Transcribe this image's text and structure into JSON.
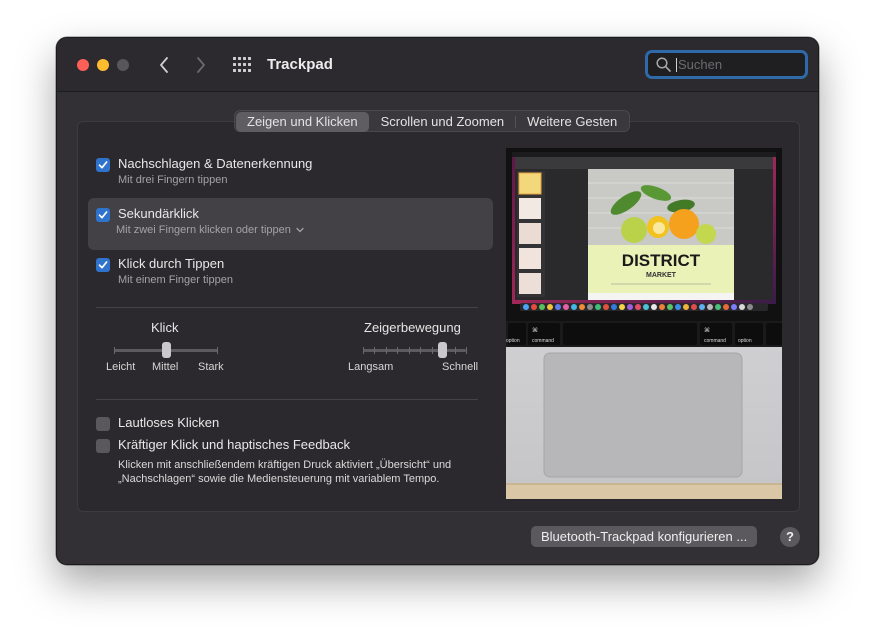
{
  "window": {
    "title": "Trackpad",
    "search_placeholder": "Suchen"
  },
  "tabs": [
    {
      "label": "Zeigen und Klicken",
      "active": true
    },
    {
      "label": "Scrollen und Zoomen",
      "active": false
    },
    {
      "label": "Weitere Gesten",
      "active": false
    }
  ],
  "options": {
    "lookup": {
      "label": "Nachschlagen & Datenerkennung",
      "sub": "Mit drei Fingern tippen",
      "checked": true
    },
    "secondary": {
      "label": "Sekundärklick",
      "sub": "Mit zwei Fingern klicken oder tippen",
      "checked": true
    },
    "tap": {
      "label": "Klick durch Tippen",
      "sub": "Mit einem Finger tippen",
      "checked": true
    },
    "silent": {
      "label": "Lautloses Klicken",
      "checked": false
    },
    "force": {
      "label": "Kräftiger Klick und haptisches Feedback",
      "checked": false,
      "description": "Klicken mit anschließendem kräftigen Druck aktiviert „Übersicht“ und „Nachschlagen“ sowie die Mediensteuerung mit variablem Tempo."
    }
  },
  "sliders": {
    "click": {
      "title": "Klick",
      "min_label": "Leicht",
      "mid_label": "Mittel",
      "max_label": "Stark",
      "steps": 3,
      "value_index": 1
    },
    "pointer": {
      "title": "Zeigerbewegung",
      "min_label": "Langsam",
      "max_label": "Schnell",
      "steps": 10,
      "value_index": 8
    }
  },
  "preview": {
    "poster_title": "DISTRICT",
    "poster_subtitle": "MARKET",
    "key_left_symbol": "⌘",
    "key_left_label": "command",
    "key_right_symbol": "⌘",
    "key_right_label": "command",
    "key_option_label": "option"
  },
  "footer": {
    "bluetooth_button": "Bluetooth-Trackpad konfigurieren ...",
    "help_label": "?"
  },
  "colors": {
    "accent": "#2f73cd",
    "close": "#fe5f57",
    "minimize": "#febc2e"
  }
}
